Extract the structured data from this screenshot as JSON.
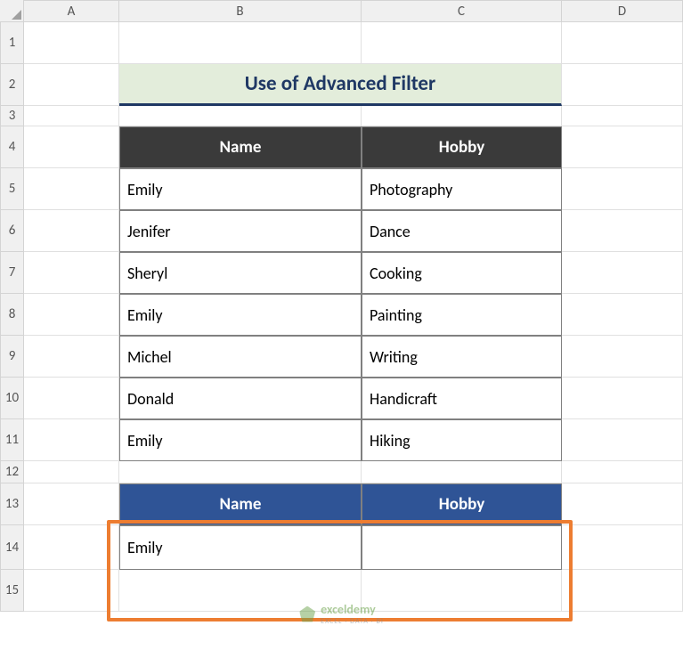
{
  "columns": [
    "A",
    "B",
    "C",
    "D"
  ],
  "rows": [
    "1",
    "2",
    "3",
    "4",
    "5",
    "6",
    "7",
    "8",
    "9",
    "10",
    "11",
    "12",
    "13",
    "14",
    "15"
  ],
  "title": "Use of Advanced Filter",
  "table1": {
    "headers": [
      "Name",
      "Hobby"
    ],
    "rows": [
      {
        "name": "Emily",
        "hobby": "Photography"
      },
      {
        "name": "Jenifer",
        "hobby": "Dance"
      },
      {
        "name": "Sheryl",
        "hobby": "Cooking"
      },
      {
        "name": "Emily",
        "hobby": "Painting"
      },
      {
        "name": "Michel",
        "hobby": "Writing"
      },
      {
        "name": "Donald",
        "hobby": "Handicraft"
      },
      {
        "name": "Emily",
        "hobby": "Hiking"
      }
    ]
  },
  "table2": {
    "headers": [
      "Name",
      "Hobby"
    ],
    "rows": [
      {
        "name": "Emily",
        "hobby": ""
      }
    ]
  },
  "watermark": {
    "main": "exceldemy",
    "sub": "EXCEL · DATA · BI"
  }
}
